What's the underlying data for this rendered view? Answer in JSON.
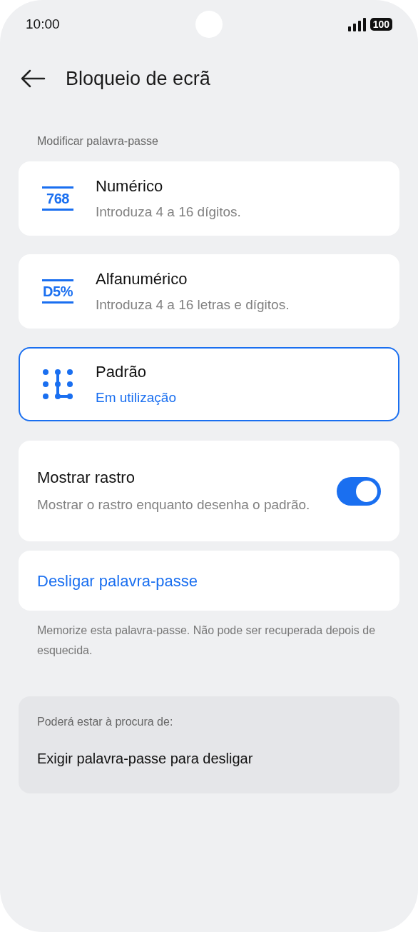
{
  "status_bar": {
    "time": "10:00",
    "battery": "100"
  },
  "header": {
    "title": "Bloqueio de ecrã"
  },
  "section_label": "Modificar palavra-passe",
  "options": [
    {
      "kind": "numeric",
      "icon_text": "768",
      "title": "Numérico",
      "subtitle": "Introduza 4 a 16 dígitos.",
      "selected": false
    },
    {
      "kind": "alphanumeric",
      "icon_text": "D5%",
      "title": "Alfanumérico",
      "subtitle": "Introduza 4 a 16 letras e dígitos.",
      "selected": false
    },
    {
      "kind": "pattern",
      "title": "Padrão",
      "subtitle": "Em utilização",
      "selected": true
    }
  ],
  "show_trace": {
    "title": "Mostrar rastro",
    "description": "Mostrar o rastro enquanto desenha o padrão.",
    "on": true
  },
  "turn_off_link": "Desligar palavra-passe",
  "note": "Memorize esta palavra-passe. Não pode ser recuperada depois de esquecida.",
  "suggestions": {
    "label": "Poderá estar à procura de:",
    "items": [
      "Exigir palavra-passe para desligar"
    ]
  }
}
